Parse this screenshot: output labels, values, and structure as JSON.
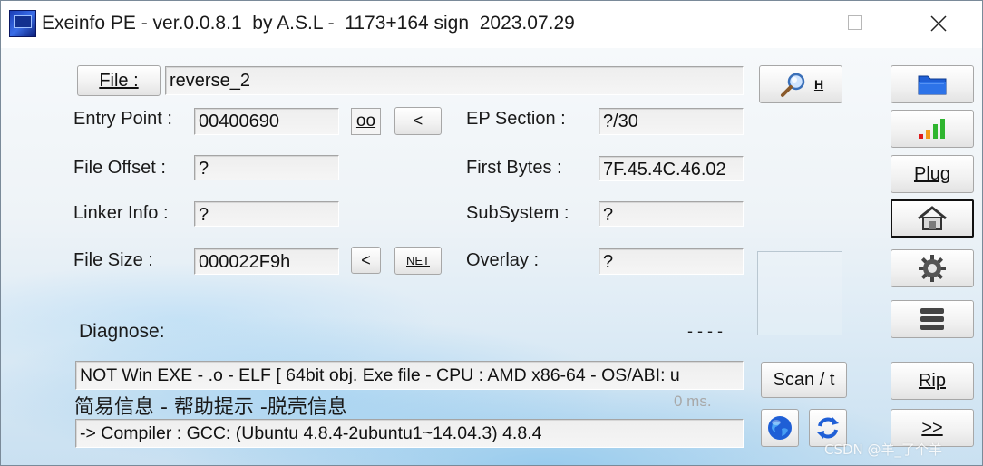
{
  "window": {
    "title": "Exeinfo PE - ver.0.0.8.1  by A.S.L -  1173+164 sign  2023.07.29"
  },
  "file": {
    "button_label": "File :",
    "path": "reverse_2",
    "search_h_label": "H"
  },
  "fields": {
    "entry_point_label": "Entry Point :",
    "entry_point_value": "00400690",
    "oo_label": "oo",
    "lt_label": "<",
    "ep_section_label": "EP Section :",
    "ep_section_value": "?/30",
    "file_offset_label": "File Offset :",
    "file_offset_value": "?",
    "first_bytes_label": "First Bytes :",
    "first_bytes_value": "7F.45.4C.46.02",
    "linker_info_label": "Linker Info :",
    "linker_info_value": "?",
    "subsystem_label": "SubSystem :",
    "subsystem_value": "?",
    "file_size_label": "File Size :",
    "file_size_value": "000022F9h",
    "size_lt_label": "<",
    "net_label": "NET",
    "overlay_label": "Overlay :",
    "overlay_value": "?"
  },
  "diagnose": {
    "label": "Diagnose:",
    "dashes": "- - - -",
    "result": "NOT Win EXE - .o - ELF  [ 64bit obj. Exe file - CPU : AMD x86-64 - OS/ABI: u",
    "chinese_hint": "简易信息 - 帮助提示 -脱壳信息",
    "time": "0 ms.",
    "compiler": " -> Compiler : GCC: (Ubuntu 4.8.4-2ubuntu1~14.04.3) 4.8.4",
    "scan_label": "Scan / t"
  },
  "sidebar": {
    "plug_label": "Plug",
    "rip_label": "Rip",
    "next_label": ">>"
  },
  "watermark": "CSDN @羊_了个羊",
  "colors": {
    "accent_blue": "#1f5fd6",
    "bar_red": "#e01b1b",
    "bar_orange": "#f29a1a",
    "bar_green": "#2fb52f"
  }
}
